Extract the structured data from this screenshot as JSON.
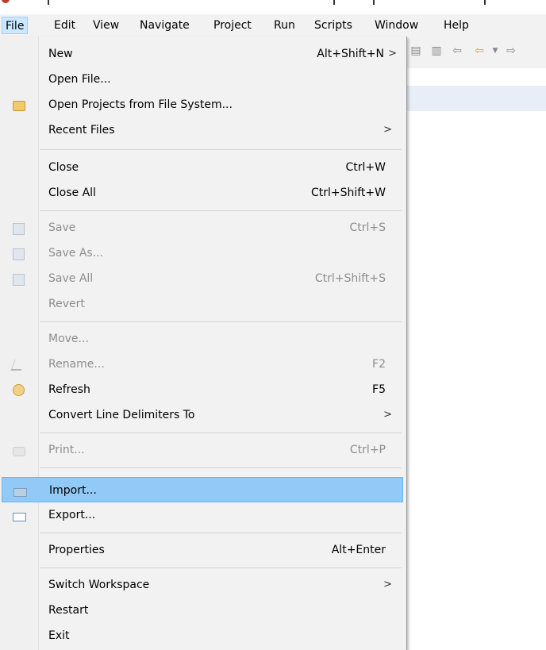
{
  "menubar": {
    "items": [
      "File",
      "Edit",
      "View",
      "Navigate",
      "Project",
      "Run",
      "Scripts",
      "Window",
      "Help"
    ]
  },
  "file_menu": {
    "new": {
      "label": "New",
      "accel": "Alt+Shift+N",
      "arrow": ">"
    },
    "open_file": {
      "label": "Open File..."
    },
    "open_projects": {
      "label": "Open Projects from File System..."
    },
    "recent_files": {
      "label": "Recent Files",
      "arrow": ">"
    },
    "close": {
      "label": "Close",
      "accel": "Ctrl+W"
    },
    "close_all": {
      "label": "Close All",
      "accel": "Ctrl+Shift+W"
    },
    "save": {
      "label": "Save",
      "accel": "Ctrl+S"
    },
    "save_as": {
      "label": "Save As..."
    },
    "save_all": {
      "label": "Save All",
      "accel": "Ctrl+Shift+S"
    },
    "revert": {
      "label": "Revert"
    },
    "move": {
      "label": "Move..."
    },
    "rename": {
      "label": "Rename...",
      "accel": "F2"
    },
    "refresh": {
      "label": "Refresh",
      "accel": "F5"
    },
    "convert": {
      "label": "Convert Line Delimiters To",
      "arrow": ">"
    },
    "print": {
      "label": "Print...",
      "accel": "Ctrl+P"
    },
    "import": {
      "label": "Import..."
    },
    "export": {
      "label": "Export..."
    },
    "properties": {
      "label": "Properties",
      "accel": "Alt+Enter"
    },
    "switch_workspace": {
      "label": "Switch Workspace",
      "arrow": ">"
    },
    "restart": {
      "label": "Restart"
    },
    "exit": {
      "label": "Exit"
    }
  },
  "colors": {
    "highlight": "#91c9f7",
    "menu_bg": "#f2f2f2",
    "disabled_text": "#8d8d8d"
  }
}
